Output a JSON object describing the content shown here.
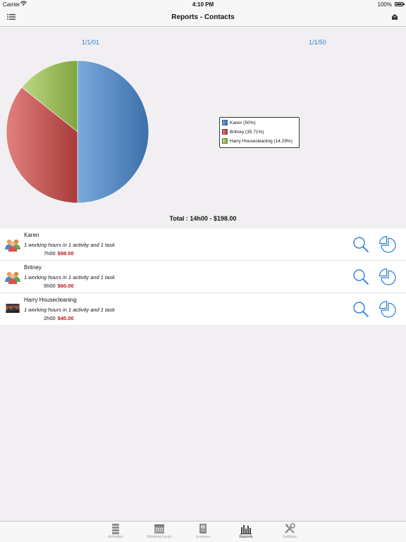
{
  "status_bar": {
    "carrier": "Carrier",
    "time": "4:10 PM",
    "battery": "100%"
  },
  "nav": {
    "title": "Reports - Contacts"
  },
  "date_range": {
    "start": "1/1/01",
    "end": "1/1/50"
  },
  "legend": [
    {
      "label": "Karen (50%)",
      "color": "#5d93c9"
    },
    {
      "label": "Britney (35.71%)",
      "color": "#c9504f"
    },
    {
      "label": "Harry Housecleaning (14.29%)",
      "color": "#9bbd55"
    }
  ],
  "chart_data": {
    "type": "pie",
    "categories": [
      "Karen",
      "Britney",
      "Harry Housecleaning"
    ],
    "values": [
      50,
      35.71,
      14.29
    ],
    "colors": [
      "#5d93c9",
      "#c9504f",
      "#9bbd55"
    ],
    "legend_placement": "right"
  },
  "total": "Total : 14h00 - $198.00",
  "contacts": [
    {
      "name": "Karen",
      "description": "1 working hours in 1 activity and 1 task",
      "hours": "7h00",
      "amount": "$98.00",
      "avatar": "people-icon"
    },
    {
      "name": "Britney",
      "description": "1 working hours in 1 activity and 1 task",
      "hours": "5h00",
      "amount": "$60.00",
      "avatar": "people-icon"
    },
    {
      "name": "Harry Housecleaning",
      "description": "1 working hours in 1 activity and 1 task",
      "hours": "2h00",
      "amount": "$40.00",
      "avatar": "landscape-photo"
    }
  ],
  "tabs": [
    {
      "label": "Activities",
      "icon": "stack-icon",
      "active": false
    },
    {
      "label": "Working hours",
      "icon": "calendar-icon",
      "active": false
    },
    {
      "label": "Invoices",
      "icon": "invoice-icon",
      "active": false
    },
    {
      "label": "Reports",
      "icon": "bar-chart-icon",
      "active": true
    },
    {
      "label": "Settings",
      "icon": "tools-icon",
      "active": false
    }
  ]
}
